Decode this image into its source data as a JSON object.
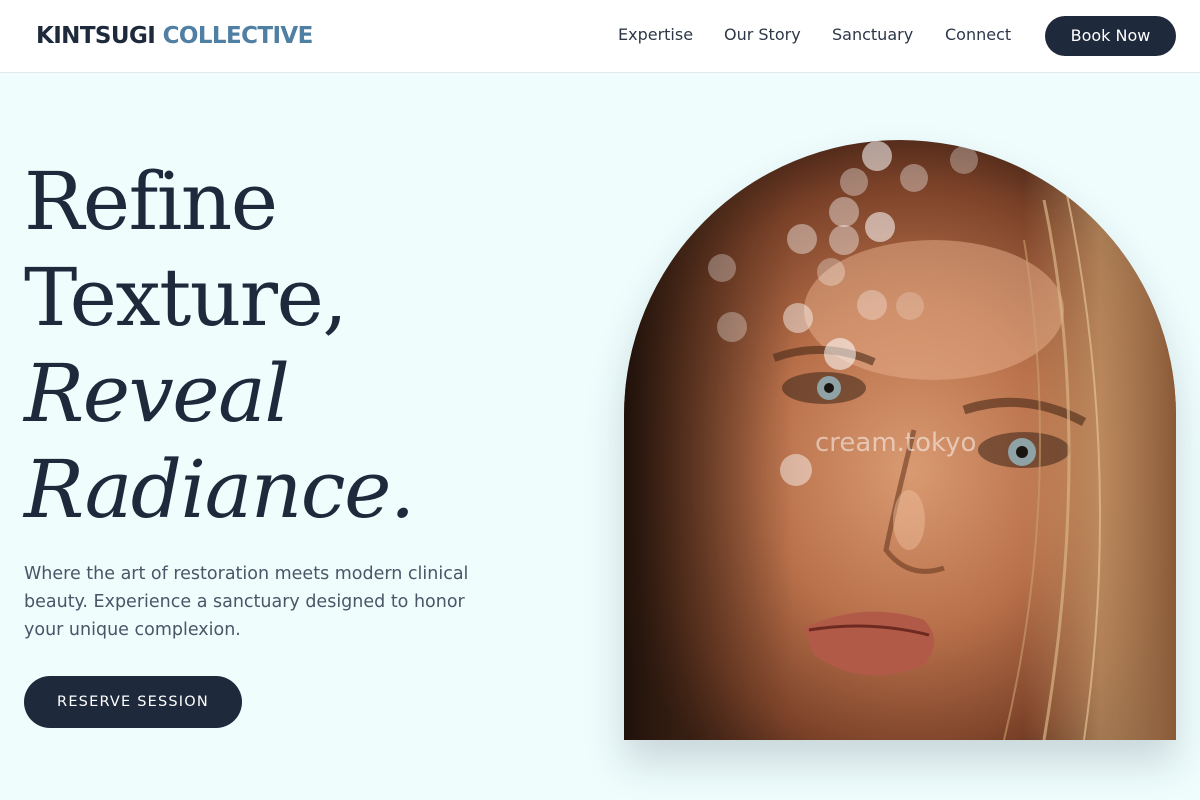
{
  "header": {
    "logo_part1": "KINTSUGI",
    "logo_part2": "COLLECTIVE",
    "nav": [
      "Expertise",
      "Our Story",
      "Sanctuary",
      "Connect"
    ],
    "book_label": "Book Now"
  },
  "hero": {
    "line1": "Refine",
    "line2": "Texture,",
    "line3": "Reveal",
    "line4": "Radiance.",
    "subtext": "Where the art of restoration meets modern clinical beauty. Experience a sanctuary designed to honor your unique complexion.",
    "cta_label": "RESERVE SESSION",
    "image_watermark": "cream.tokyo"
  },
  "colors": {
    "background": "#effdfd",
    "navy": "#1e293b",
    "logo_accent": "#4f7fa3",
    "header_bg": "#ffffff"
  }
}
